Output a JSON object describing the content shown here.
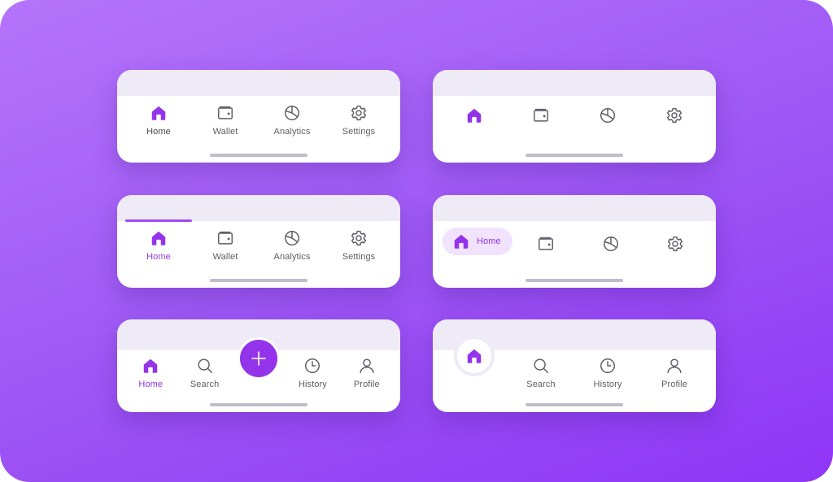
{
  "theme": {
    "accent": "#9333ea",
    "inactive": "#5f5c66",
    "top_bar": "#eeeaf6",
    "background_start": "#b574fb",
    "background_end": "#8f35f6"
  },
  "cards": [
    {
      "variant": "icon-and-label",
      "items": [
        {
          "label": "Home",
          "icon": "home-icon",
          "active": true
        },
        {
          "label": "Wallet",
          "icon": "wallet-icon",
          "active": false
        },
        {
          "label": "Analytics",
          "icon": "pie-chart-icon",
          "active": false
        },
        {
          "label": "Settings",
          "icon": "gear-icon",
          "active": false
        }
      ]
    },
    {
      "variant": "icons-only",
      "items": [
        {
          "label": "Home",
          "icon": "home-icon",
          "active": true
        },
        {
          "label": "Wallet",
          "icon": "wallet-icon",
          "active": false
        },
        {
          "label": "Analytics",
          "icon": "pie-chart-icon",
          "active": false
        },
        {
          "label": "Settings",
          "icon": "gear-icon",
          "active": false
        }
      ]
    },
    {
      "variant": "top-indicator",
      "items": [
        {
          "label": "Home",
          "icon": "home-icon",
          "active": true
        },
        {
          "label": "Wallet",
          "icon": "wallet-icon",
          "active": false
        },
        {
          "label": "Analytics",
          "icon": "pie-chart-icon",
          "active": false
        },
        {
          "label": "Settings",
          "icon": "gear-icon",
          "active": false
        }
      ]
    },
    {
      "variant": "pill",
      "items": [
        {
          "label": "Home",
          "icon": "home-icon",
          "active": true
        },
        {
          "label": "Wallet",
          "icon": "wallet-icon",
          "active": false
        },
        {
          "label": "Analytics",
          "icon": "pie-chart-icon",
          "active": false
        },
        {
          "label": "Settings",
          "icon": "gear-icon",
          "active": false
        }
      ]
    },
    {
      "variant": "center-fab",
      "items": [
        {
          "label": "Home",
          "icon": "home-icon",
          "active": true
        },
        {
          "label": "Search",
          "icon": "search-icon",
          "active": false
        },
        {
          "label": "Add",
          "icon": "plus-icon",
          "active": false
        },
        {
          "label": "History",
          "icon": "clock-icon",
          "active": false
        },
        {
          "label": "Profile",
          "icon": "user-icon",
          "active": false
        }
      ]
    },
    {
      "variant": "raised-ring",
      "items": [
        {
          "label": "Home",
          "icon": "home-icon",
          "active": true
        },
        {
          "label": "Search",
          "icon": "search-icon",
          "active": false
        },
        {
          "label": "History",
          "icon": "clock-icon",
          "active": false
        },
        {
          "label": "Profile",
          "icon": "user-icon",
          "active": false
        }
      ]
    }
  ]
}
